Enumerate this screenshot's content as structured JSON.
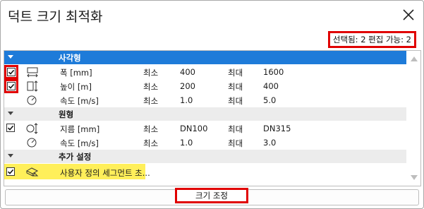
{
  "window": {
    "title": "덕트 크기 최적화"
  },
  "summary": "선택됨: 2 편집 가능: 2",
  "groups": [
    {
      "label": "사각형",
      "items": [
        {
          "name": "폭 [mm]",
          "min_label": "최소",
          "min": "400",
          "max_label": "최대",
          "max": "1600",
          "checked": true,
          "icon": "width-dimension-icon"
        },
        {
          "name": "높이 [m]",
          "min_label": "최소",
          "min": "200",
          "max_label": "최대",
          "max": "400",
          "checked": true,
          "icon": "height-dimension-icon"
        },
        {
          "name": "속도 [m/s]",
          "min_label": "최소",
          "min": "1.0",
          "max_label": "최대",
          "max": "5.0",
          "checked": false,
          "icon": "velocity-gauge-icon"
        }
      ]
    },
    {
      "label": "원형",
      "items": [
        {
          "name": "지름 [mm]",
          "min_label": "최소",
          "min": "DN100",
          "max_label": "최대",
          "max": "DN315",
          "checked": true,
          "icon": "diameter-icon"
        },
        {
          "name": "속도 [m/s]",
          "min_label": "최소",
          "min": "1.0",
          "max_label": "최대",
          "max": "3.0",
          "checked": false,
          "icon": "velocity-gauge-icon"
        }
      ]
    },
    {
      "label": "추가 설정",
      "items": [
        {
          "name": "사용자 정의 세그먼트 초...",
          "checked": true,
          "icon": "custom-segment-icon"
        }
      ]
    }
  ],
  "footer": {
    "button_label": "크기 조정"
  },
  "colors": {
    "selection": "#1e7bd9",
    "highlight": "#ffef5a",
    "annotation": "#e00000"
  }
}
